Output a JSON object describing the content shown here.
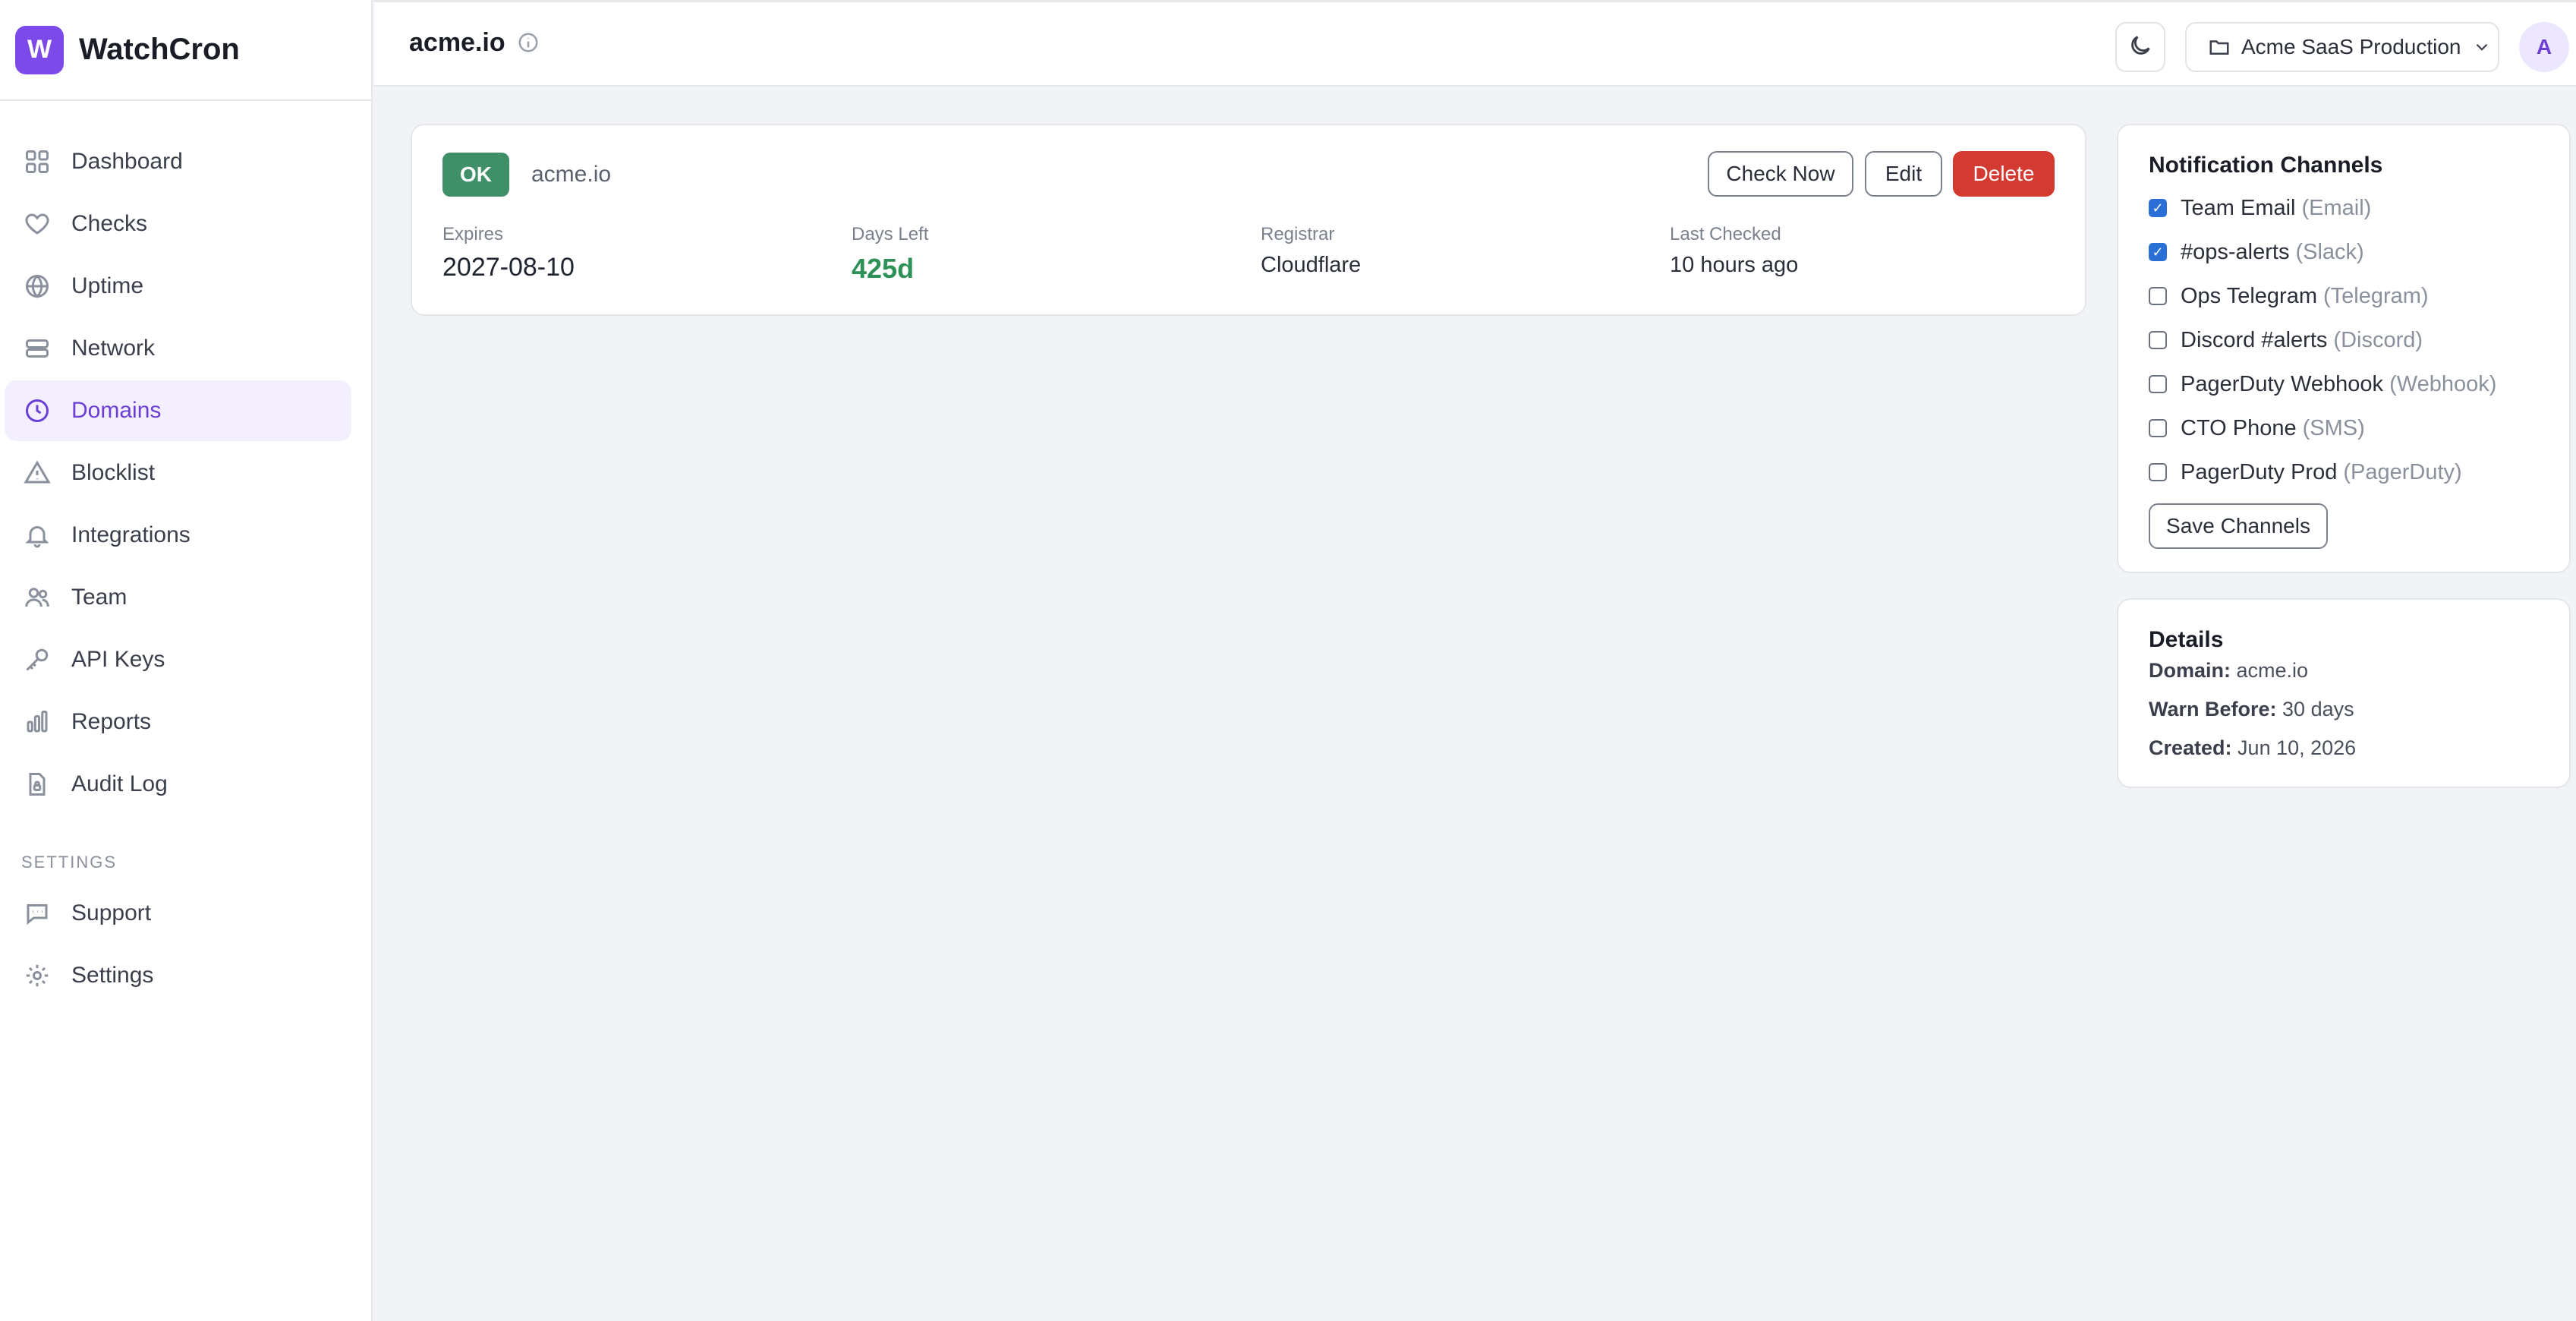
{
  "app": {
    "logo_letter": "W",
    "name": "WatchCron"
  },
  "sidebar": {
    "items": [
      {
        "label": "Dashboard",
        "icon": "grid-icon"
      },
      {
        "label": "Checks",
        "icon": "heart-icon"
      },
      {
        "label": "Uptime",
        "icon": "globe-icon"
      },
      {
        "label": "Network",
        "icon": "server-icon"
      },
      {
        "label": "Domains",
        "icon": "clock-icon",
        "active": true
      },
      {
        "label": "Blocklist",
        "icon": "warning-icon"
      },
      {
        "label": "Integrations",
        "icon": "bell-icon"
      },
      {
        "label": "Team",
        "icon": "users-icon"
      },
      {
        "label": "API Keys",
        "icon": "key-icon"
      },
      {
        "label": "Reports",
        "icon": "bar-chart-icon"
      },
      {
        "label": "Audit Log",
        "icon": "file-lock-icon"
      }
    ],
    "settings_section": "SETTINGS",
    "settings_items": [
      {
        "label": "Support",
        "icon": "chat-icon"
      },
      {
        "label": "Settings",
        "icon": "gear-icon"
      }
    ]
  },
  "header": {
    "title": "acme.io",
    "org_select": "Acme SaaS Production",
    "avatar_letter": "A"
  },
  "domain": {
    "status": "OK",
    "name": "acme.io",
    "buttons": {
      "check_now": "Check Now",
      "edit": "Edit",
      "delete": "Delete"
    },
    "fields": [
      {
        "label": "Expires",
        "value": "2027-08-10"
      },
      {
        "label": "Days Left",
        "value": "425d"
      },
      {
        "label": "Registrar",
        "value": "Cloudflare"
      },
      {
        "label": "Last Checked",
        "value": "10 hours ago"
      }
    ]
  },
  "notifications": {
    "title": "Notification Channels",
    "channels": [
      {
        "name": "Team Email",
        "type": "(Email)",
        "checked": true
      },
      {
        "name": "#ops-alerts",
        "type": "(Slack)",
        "checked": true
      },
      {
        "name": "Ops Telegram",
        "type": "(Telegram)",
        "checked": false
      },
      {
        "name": "Discord #alerts",
        "type": "(Discord)",
        "checked": false
      },
      {
        "name": "PagerDuty Webhook",
        "type": "(Webhook)",
        "checked": false
      },
      {
        "name": "CTO Phone",
        "type": "(SMS)",
        "checked": false
      },
      {
        "name": "PagerDuty Prod",
        "type": "(PagerDuty)",
        "checked": false
      }
    ],
    "save_label": "Save Channels"
  },
  "details": {
    "title": "Details",
    "rows": [
      {
        "label": "Domain:",
        "value": "acme.io"
      },
      {
        "label": "Warn Before:",
        "value": "30 days"
      },
      {
        "label": "Created:",
        "value": "Jun 10, 2026"
      }
    ]
  },
  "colors": {
    "accent": "#7c4ae8",
    "ok_green": "#3f8f68",
    "danger": "#d33a32",
    "checkbox_blue": "#2a6fd6"
  }
}
